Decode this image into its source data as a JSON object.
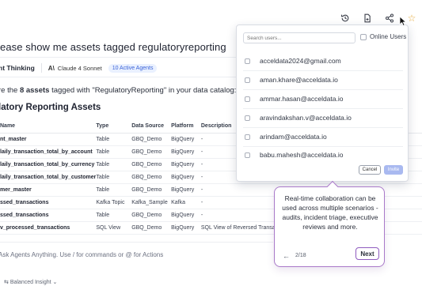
{
  "header": {
    "icons": [
      "history-icon",
      "document-export-icon",
      "share-icon",
      "star-icon"
    ]
  },
  "chat": {
    "question": "lease show me assets tagged regulatoryreporting",
    "thinking_label": "nt Thinking",
    "model": "Claude 4 Sonnet",
    "agents_badge": "10 Active Agents",
    "intro_prefix": "re the ",
    "intro_bold": "8 assets",
    "intro_suffix": " tagged with \"RegulatoryReporting\" in your data catalog:",
    "section_title": "latory Reporting Assets"
  },
  "table": {
    "headers": [
      "Name",
      "Type",
      "Data Source",
      "Platform",
      "Description"
    ],
    "rows": [
      [
        "nt_master",
        "Table",
        "GBQ_Demo",
        "BigQuery",
        "-"
      ],
      [
        "laily_transaction_total_by_account",
        "Table",
        "GBQ_Demo",
        "BigQuery",
        "-"
      ],
      [
        "laily_transaction_total_by_currency",
        "Table",
        "GBQ_Demo",
        "BigQuery",
        "-"
      ],
      [
        "laily_transaction_total_by_customer",
        "Table",
        "GBQ_Demo",
        "BigQuery",
        "-"
      ],
      [
        "mer_master",
        "Table",
        "GBQ_Demo",
        "BigQuery",
        "-"
      ],
      [
        "ssed_transactions",
        "Kafka Topic",
        "Kafka_Sample",
        "Kafka",
        "-"
      ],
      [
        "ssed_transactions",
        "Table",
        "GBQ_Demo",
        "BigQuery",
        "-"
      ],
      [
        "v_processed_transactions",
        "SQL View",
        "GBQ_Demo",
        "BigQuery",
        "SQL View of Reversed Transact                              porting and ha"
      ]
    ]
  },
  "ask": {
    "placeholder": "Ask Agents Anything. Use / for commands or @ for Actions",
    "mode": "Balanced Insight"
  },
  "share_panel": {
    "search_placeholder": "Search users...",
    "online_label": "Online Users",
    "users": [
      "acceldata2024@gmail.com",
      "aman.khare@acceldata.io",
      "ammar.hasan@acceldata.io",
      "aravindakshan.v@acceldata.io",
      "arindam@acceldata.io",
      "babu.mahesh@acceldata.io"
    ],
    "cancel_label": "Cancel",
    "invite_label": "Invite"
  },
  "tour": {
    "message": "Real-time collaboration can be used across multiple scenarios - audits, incident triage, executive reviews and more.",
    "back": "←",
    "step": "2/18",
    "next_label": "Next"
  }
}
